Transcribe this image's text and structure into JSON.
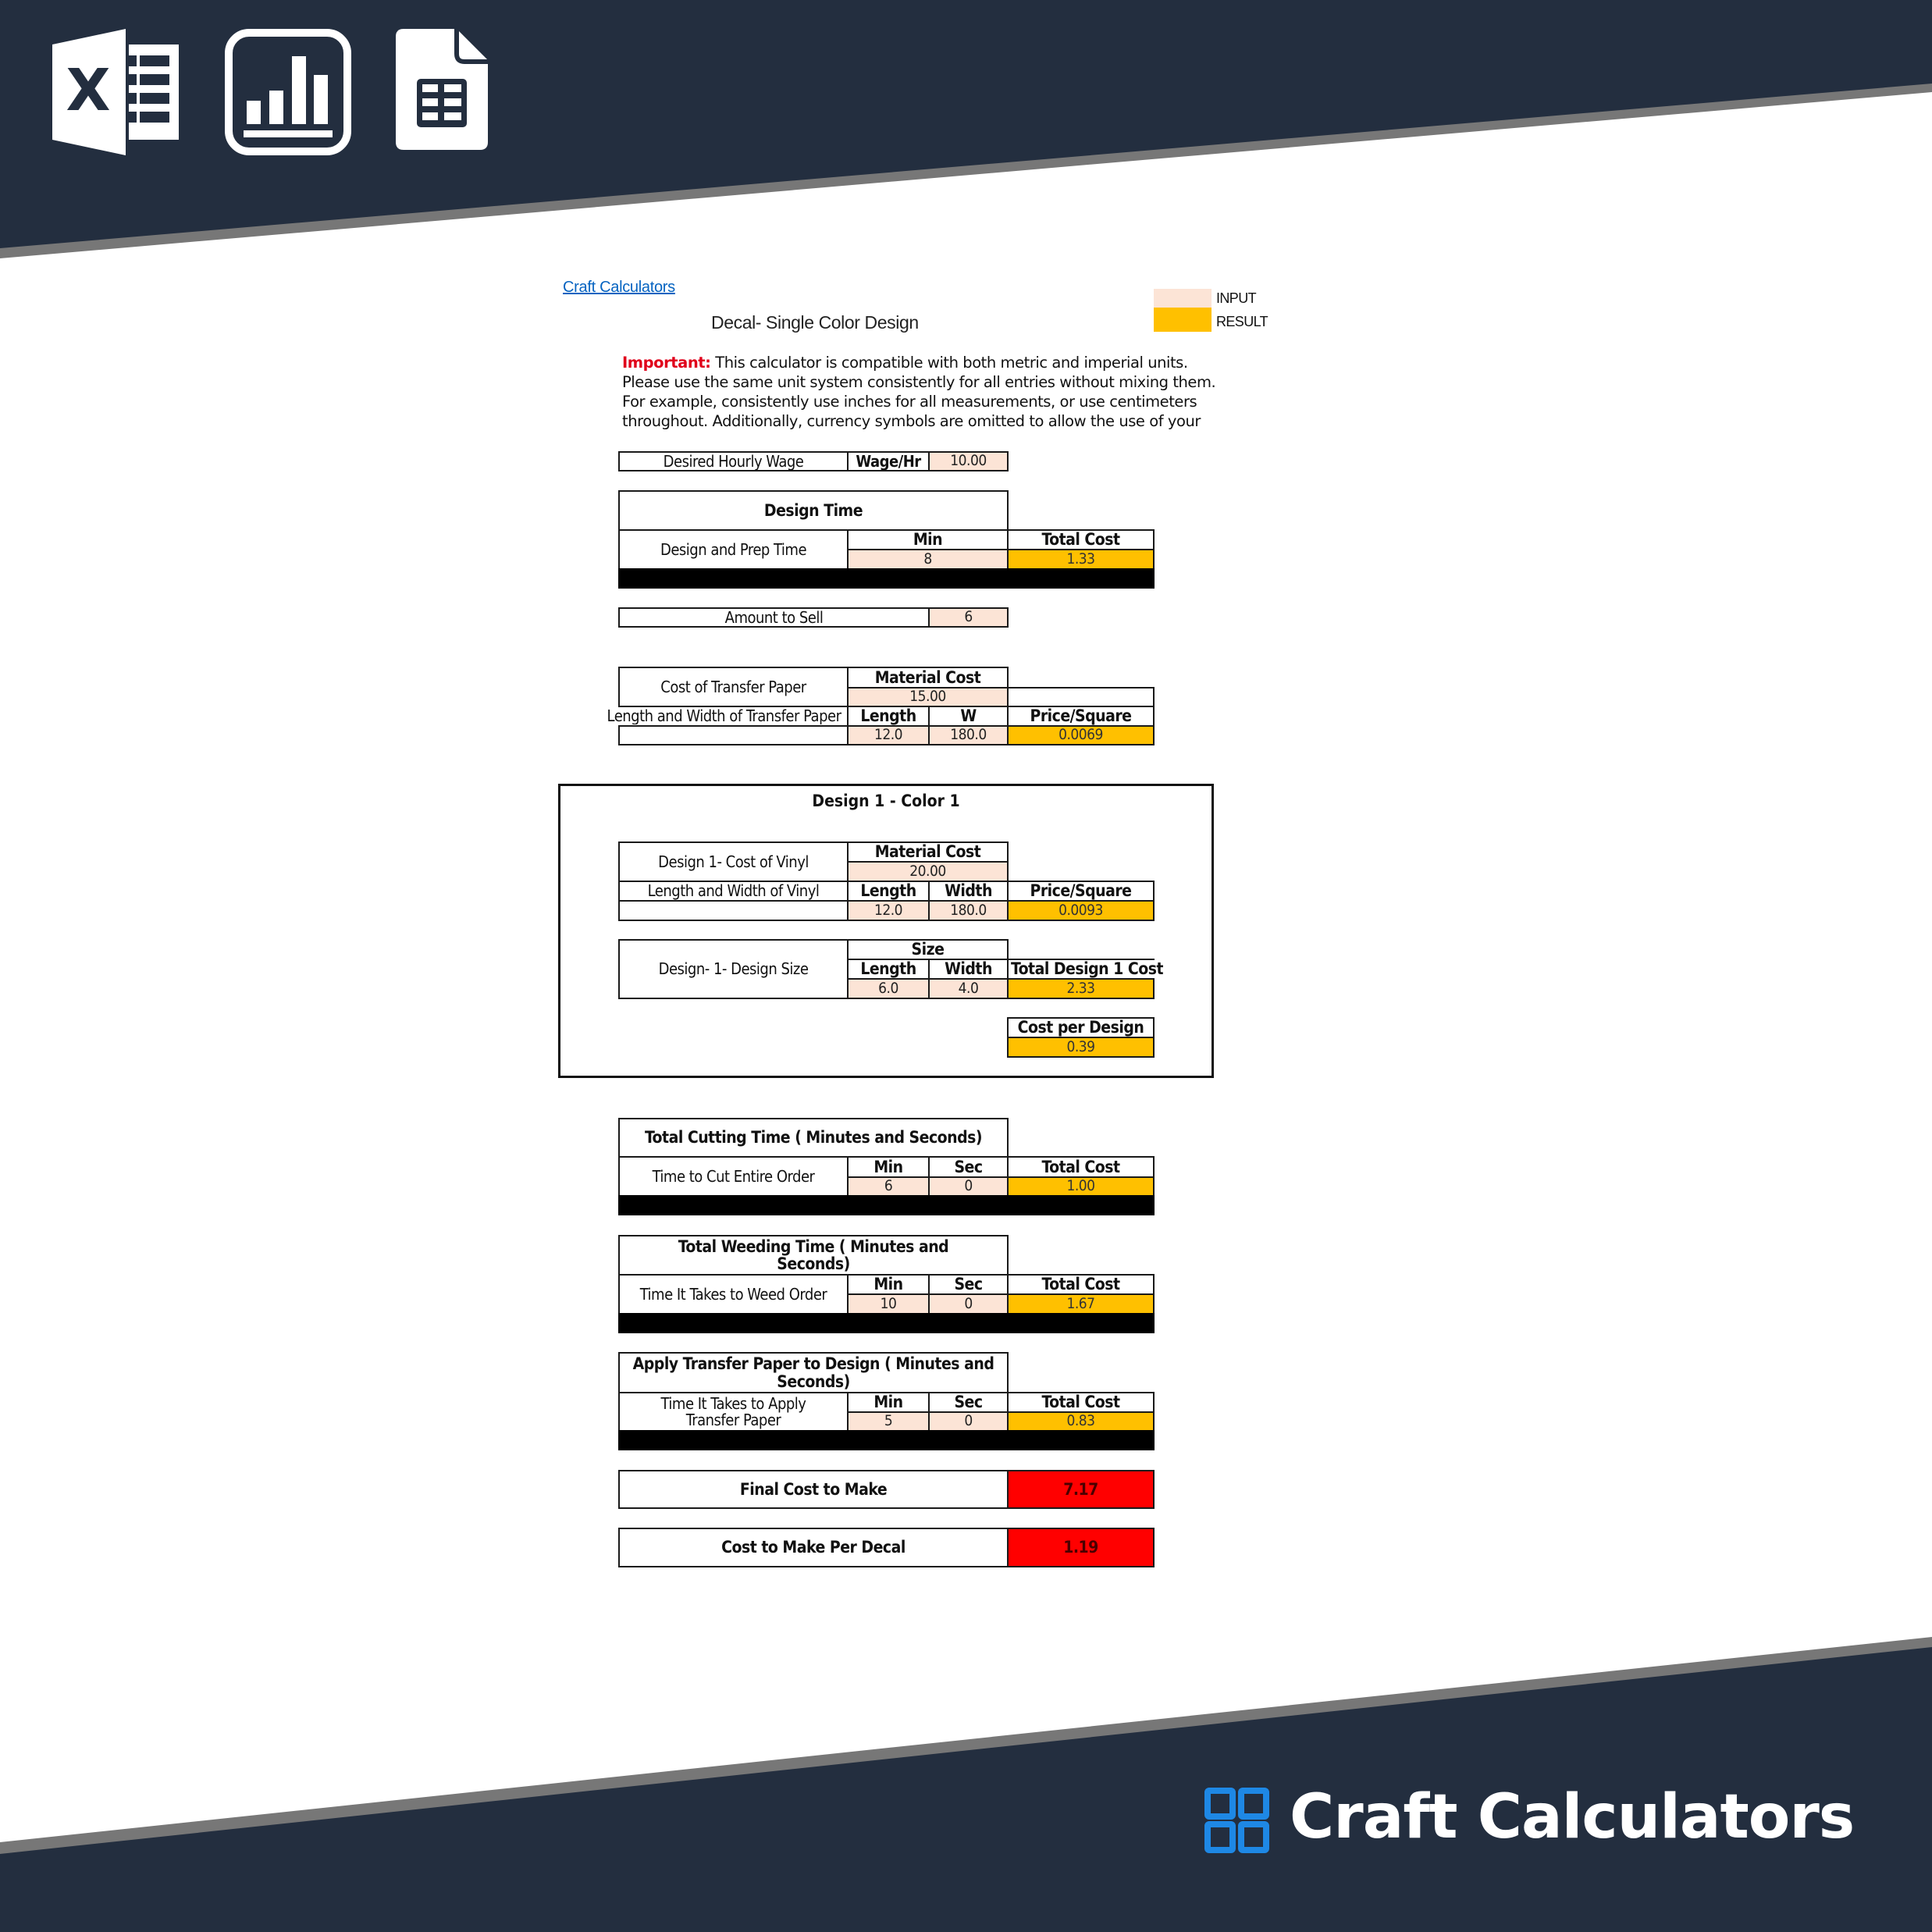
{
  "colors": {
    "navy": "#232e3f",
    "stripe": "#777777",
    "input": "#fce4d6",
    "result": "#ffc000",
    "final": "#ff0000",
    "link": "#0563c1",
    "important": "#e0001b",
    "logo_blue": "#1e88e5"
  },
  "header_icons": [
    "excel-icon",
    "bar-chart-icon",
    "google-sheets-icon"
  ],
  "sheet": {
    "link": "Craft Calculators",
    "title": "Decal- Single Color Design",
    "legend": {
      "input": "INPUT",
      "result": "RESULT"
    },
    "important_label": "Important:",
    "important_lines": [
      " This calculator is compatible with both metric and imperial units.",
      "Please use the same unit system consistently for all entries without mixing them.",
      "For example, consistently use inches for all measurements, or use centimeters",
      "throughout. Additionally, currency symbols are omitted to allow the use of your"
    ],
    "wage": {
      "label": "Desired Hourly Wage",
      "unit": "Wage/Hr",
      "value": "10.00"
    },
    "design_time": {
      "title": "Design Time",
      "row_label": "Design and Prep Time",
      "min_header": "Min",
      "cost_header": "Total Cost",
      "min": "8",
      "total_cost": "1.33"
    },
    "amount": {
      "label": "Amount to Sell",
      "value": "6"
    },
    "transfer_paper": {
      "cost_label": "Cost of Transfer Paper",
      "material_header": "Material Cost",
      "material_cost": "15.00",
      "size_label": "Length and Width of Transfer Paper",
      "length_header": "Length",
      "width_header": "W",
      "price_header": "Price/Square",
      "length": "12.0",
      "width": "180.0",
      "price_per_square": "0.0069"
    },
    "design1": {
      "title": "Design 1 - Color 1",
      "vinyl_cost_label": "Design 1- Cost of Vinyl",
      "material_header": "Material Cost",
      "material_cost": "20.00",
      "vinyl_size_label": "Length and Width of Vinyl",
      "length_header": "Length",
      "width_header": "Width",
      "price_header": "Price/Square",
      "length": "12.0",
      "width": "180.0",
      "price_per_square": "0.0093",
      "design_size_label": "Design- 1- Design Size",
      "size_header": "Size",
      "size_length_header": "Length",
      "size_width_header": "Width",
      "total_header": "Total Design 1 Cost",
      "size_length": "6.0",
      "size_width": "4.0",
      "total_cost": "2.33",
      "cost_per_design_header": "Cost per Design",
      "cost_per_design": "0.39"
    },
    "cutting": {
      "title": "Total Cutting Time ( Minutes and Seconds)",
      "row_label": "Time to Cut Entire Order",
      "min_header": "Min",
      "sec_header": "Sec",
      "cost_header": "Total Cost",
      "min": "6",
      "sec": "0",
      "total_cost": "1.00"
    },
    "weeding": {
      "title": "Total Weeding Time ( Minutes and Seconds)",
      "row_label": "Time It Takes to Weed Order",
      "min_header": "Min",
      "sec_header": "Sec",
      "cost_header": "Total Cost",
      "min": "10",
      "sec": "0",
      "total_cost": "1.67"
    },
    "apply": {
      "title": "Apply Transfer Paper to Design ( Minutes and Seconds)",
      "row_label": "Time It Takes to Apply Transfer Paper",
      "min_header": "Min",
      "sec_header": "Sec",
      "cost_header": "Total Cost",
      "min": "5",
      "sec": "0",
      "total_cost": "0.83"
    },
    "final_cost": {
      "label": "Final Cost to Make",
      "value": "7.17"
    },
    "per_decal": {
      "label": "Cost to Make Per Decal",
      "value": "1.19"
    }
  },
  "footer": {
    "brand": "Craft Calculators"
  }
}
